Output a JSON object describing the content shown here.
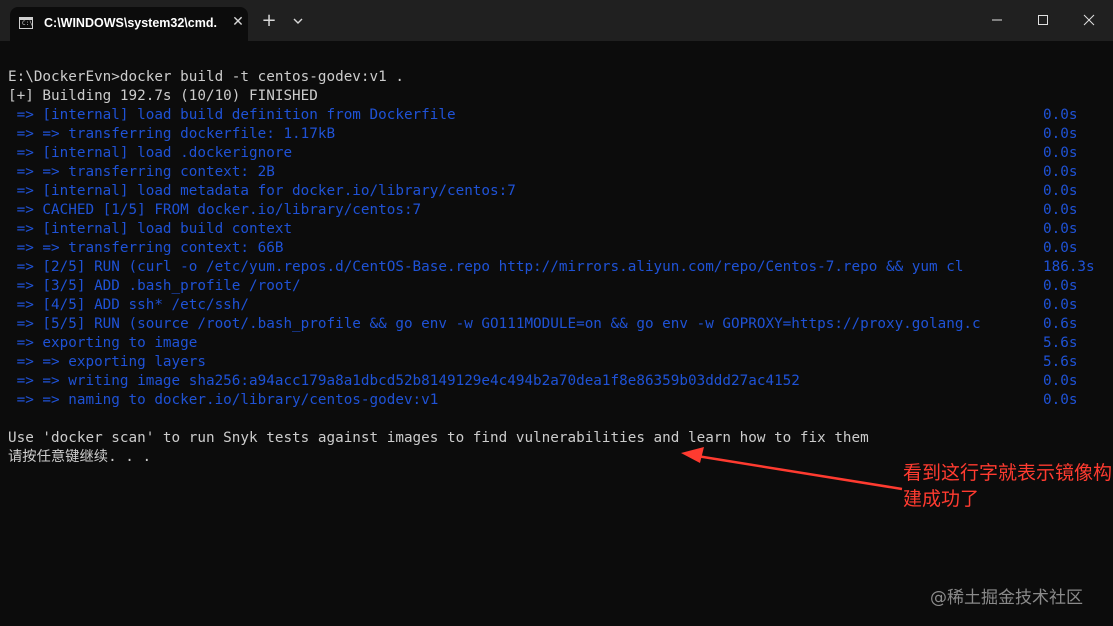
{
  "window": {
    "tab_title": "C:\\WINDOWS\\system32\\cmd.",
    "icons": [
      "cmd-icon",
      "close-icon",
      "plus-icon",
      "chevron-down-icon",
      "minimize-icon",
      "maximize-icon",
      "close-icon"
    ]
  },
  "terminal": {
    "lines": [
      {
        "text": "E:\\DockerEvn>docker build -t centos-godev:v1 .",
        "color": "white",
        "time": ""
      },
      {
        "text": "[+] Building 192.7s (10/10) FINISHED",
        "color": "white",
        "time": ""
      },
      {
        "text": " => [internal] load build definition from Dockerfile",
        "color": "blue",
        "time": "0.0s"
      },
      {
        "text": " => => transferring dockerfile: 1.17kB",
        "color": "blue",
        "time": "0.0s"
      },
      {
        "text": " => [internal] load .dockerignore",
        "color": "blue",
        "time": "0.0s"
      },
      {
        "text": " => => transferring context: 2B",
        "color": "blue",
        "time": "0.0s"
      },
      {
        "text": " => [internal] load metadata for docker.io/library/centos:7",
        "color": "blue",
        "time": "0.0s"
      },
      {
        "text": " => CACHED [1/5] FROM docker.io/library/centos:7",
        "color": "blue",
        "time": "0.0s"
      },
      {
        "text": " => [internal] load build context",
        "color": "blue",
        "time": "0.0s"
      },
      {
        "text": " => => transferring context: 66B",
        "color": "blue",
        "time": "0.0s"
      },
      {
        "text": " => [2/5] RUN (curl -o /etc/yum.repos.d/CentOS-Base.repo http://mirrors.aliyun.com/repo/Centos-7.repo && yum cl",
        "color": "blue",
        "time": "186.3s"
      },
      {
        "text": " => [3/5] ADD .bash_profile /root/",
        "color": "blue",
        "time": "0.0s"
      },
      {
        "text": " => [4/5] ADD ssh* /etc/ssh/",
        "color": "blue",
        "time": "0.0s"
      },
      {
        "text": " => [5/5] RUN (source /root/.bash_profile && go env -w GO111MODULE=on && go env -w GOPROXY=https://proxy.golang.c",
        "color": "blue",
        "time": "0.6s"
      },
      {
        "text": " => exporting to image",
        "color": "blue",
        "time": "5.6s"
      },
      {
        "text": " => => exporting layers",
        "color": "blue",
        "time": "5.6s"
      },
      {
        "text": " => => writing image sha256:a94acc179a8a1dbcd52b8149129e4c494b2a70dea1f8e86359b03ddd27ac4152",
        "color": "blue",
        "time": "0.0s"
      },
      {
        "text": " => => naming to docker.io/library/centos-godev:v1",
        "color": "blue",
        "time": "0.0s"
      },
      {
        "text": "",
        "color": "white",
        "time": ""
      },
      {
        "text": "Use 'docker scan' to run Snyk tests against images to find vulnerabilities and learn how to fix them",
        "color": "white",
        "time": ""
      },
      {
        "text": "请按任意键继续. . .",
        "color": "white",
        "time": ""
      }
    ]
  },
  "annotation": {
    "text": "看到这行字就表示镜像构建成功了",
    "color": "#ff3b30"
  },
  "watermark": "@稀土掘金技术社区"
}
